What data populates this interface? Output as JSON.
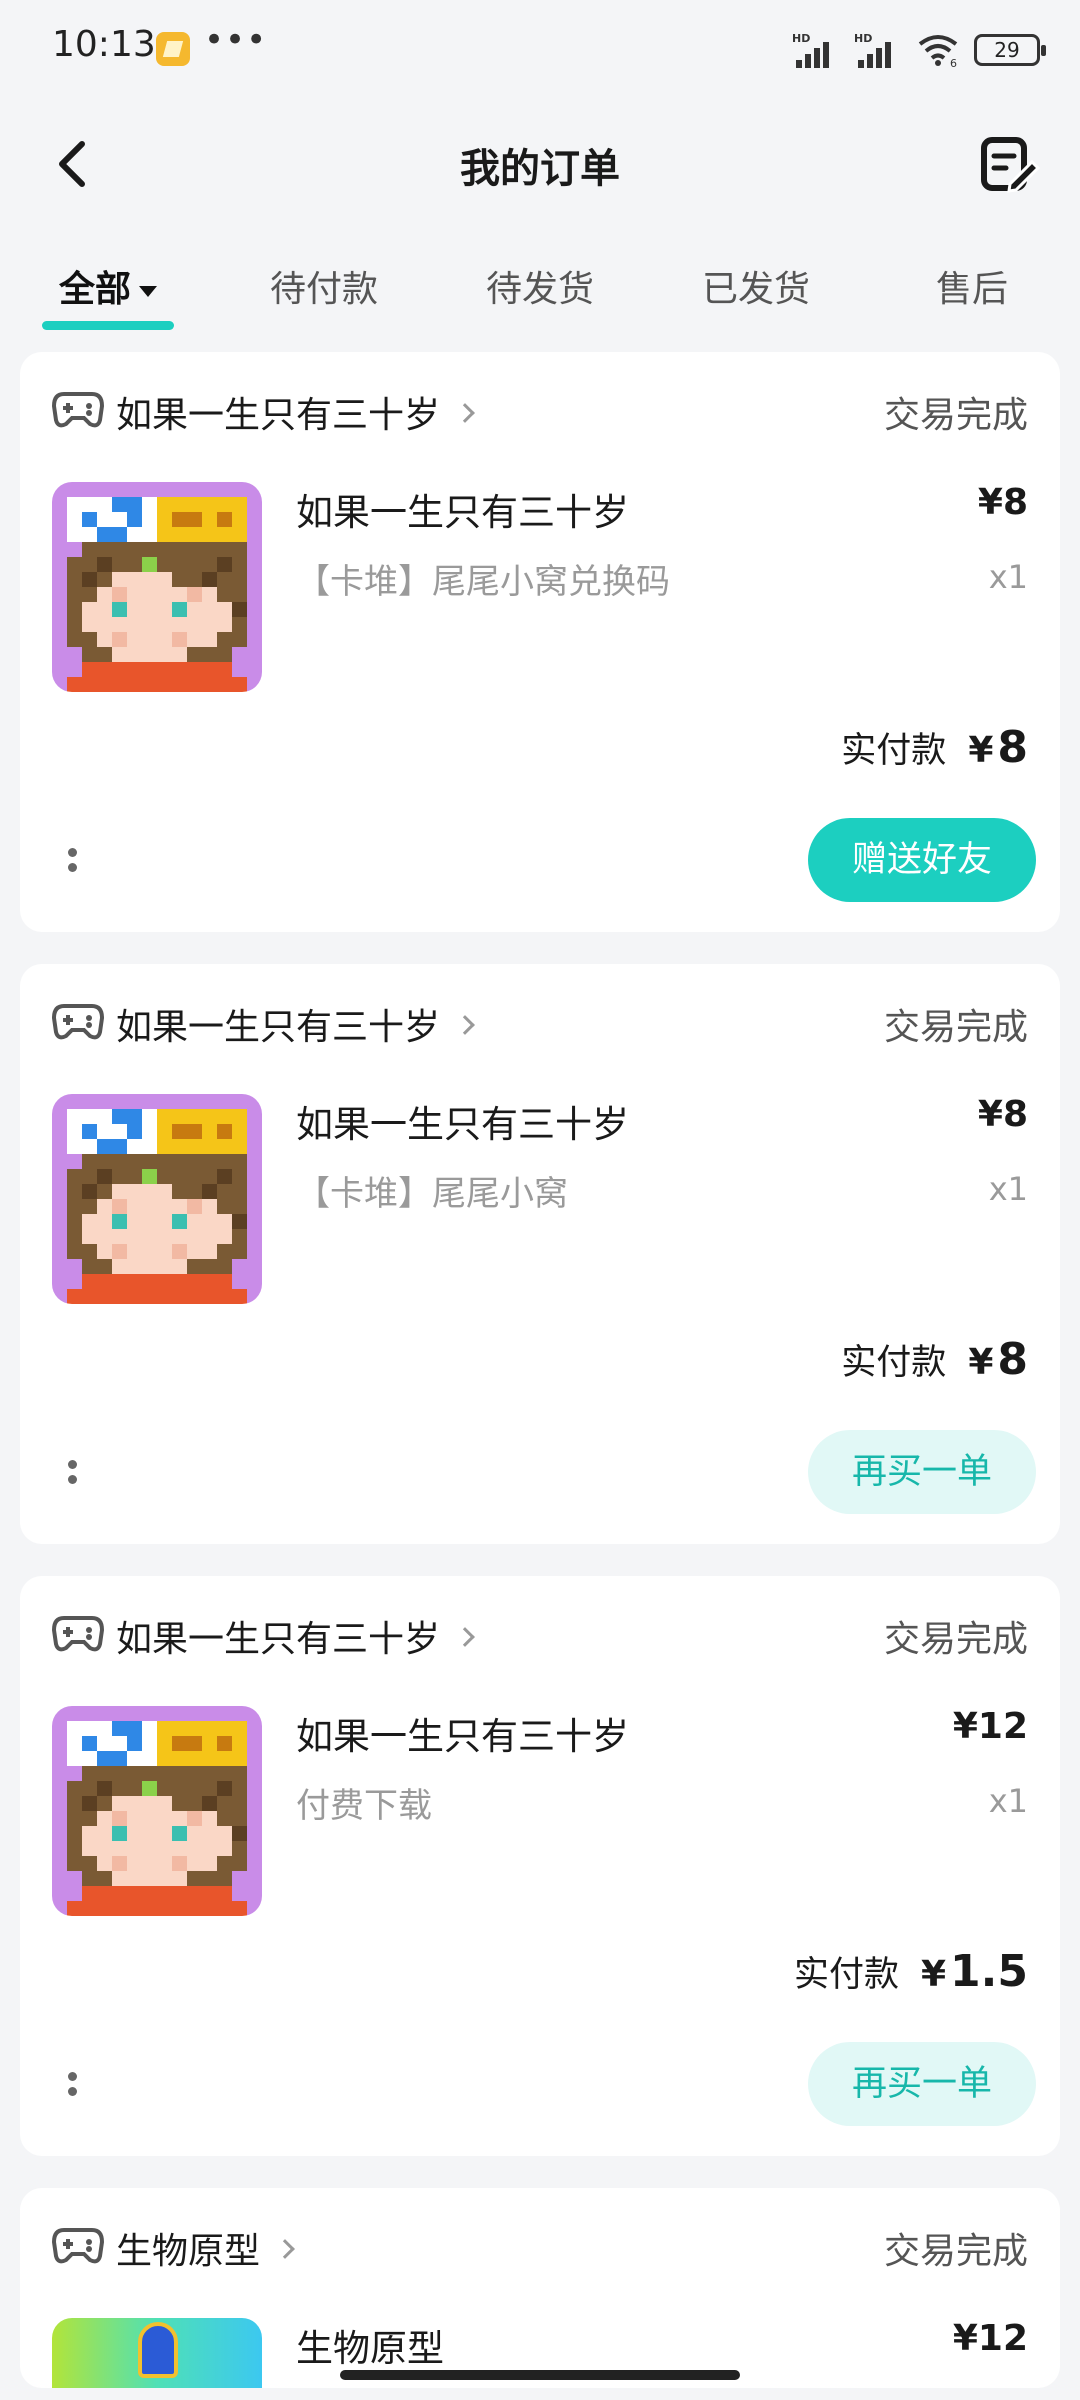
{
  "status_bar": {
    "time": "10:13",
    "signal1_label": "HD",
    "signal2_label": "HD",
    "wifi_label": "6",
    "battery": "29"
  },
  "header": {
    "title": "我的订单",
    "back_icon": "chevron-left-icon",
    "edit_icon": "order-edit-icon"
  },
  "tabs": [
    {
      "label": "全部",
      "active": true
    },
    {
      "label": "待付款",
      "active": false
    },
    {
      "label": "待发货",
      "active": false
    },
    {
      "label": "已发货",
      "active": false
    },
    {
      "label": "售后",
      "active": false
    }
  ],
  "colors": {
    "accent": "#1ccfc0",
    "accent_light": "#e1f8f6",
    "background": "#f4f5f7"
  },
  "orders": [
    {
      "store": "如果一生只有三十岁",
      "status": "交易完成",
      "product_name": "如果一生只有三十岁",
      "product_desc": "【卡堆】尾尾小窝兑换码",
      "price": "¥8",
      "qty": "x1",
      "paid_label": "实付款",
      "paid_currency": "¥",
      "paid_amount": "8",
      "action": "赠送好友",
      "action_style": "primary"
    },
    {
      "store": "如果一生只有三十岁",
      "status": "交易完成",
      "product_name": "如果一生只有三十岁",
      "product_desc": "【卡堆】尾尾小窝",
      "price": "¥8",
      "qty": "x1",
      "paid_label": "实付款",
      "paid_currency": "¥",
      "paid_amount": "8",
      "action": "再买一单",
      "action_style": "secondary"
    },
    {
      "store": "如果一生只有三十岁",
      "status": "交易完成",
      "product_name": "如果一生只有三十岁",
      "product_desc": "付费下载",
      "price": "¥12",
      "qty": "x1",
      "paid_label": "实付款",
      "paid_currency": "¥",
      "paid_amount": "1.5",
      "action": "再买一单",
      "action_style": "secondary"
    },
    {
      "store": "生物原型",
      "status": "交易完成",
      "product_name": "生物原型",
      "price": "¥12"
    }
  ]
}
